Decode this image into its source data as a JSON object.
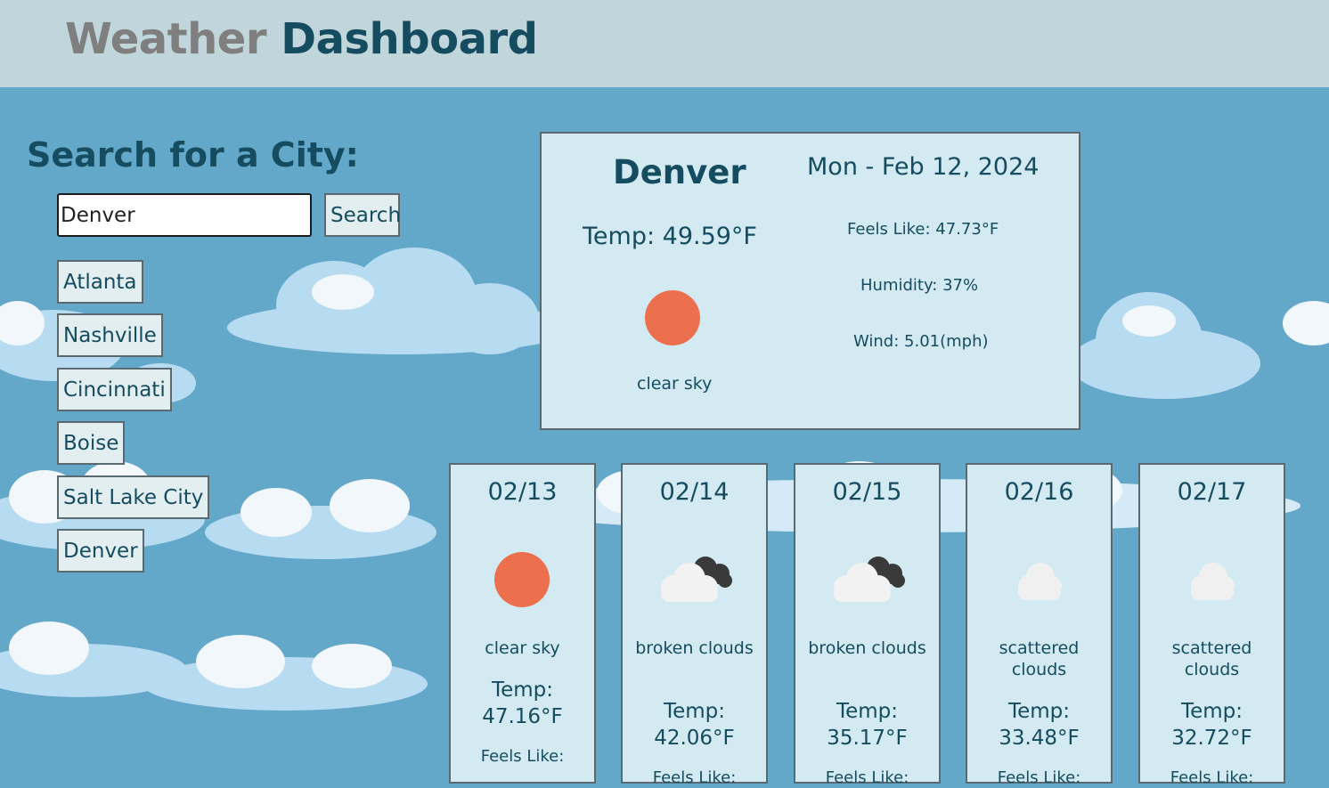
{
  "header": {
    "title_part1": "Weather",
    "title_part2": "Dashboard"
  },
  "search": {
    "title": "Search for a City:",
    "input_value": "Denver",
    "button_label": "Search",
    "history": [
      "Atlanta",
      "Nashville",
      "Cincinnati",
      "Boise",
      "Salt Lake City",
      "Denver"
    ]
  },
  "current": {
    "city": "Denver",
    "date": "Mon - Feb 12, 2024",
    "temp": "Temp:  49.59°F",
    "feels_like": "Feels Like:  47.73°F",
    "humidity": "Humidity:  37%",
    "wind": "Wind:  5.01(mph)",
    "description": "clear sky",
    "icon": "sun-icon"
  },
  "forecast": [
    {
      "date": "02/13",
      "icon": "sun-icon",
      "desc": "clear sky",
      "temp_label": "Temp:",
      "temp": "47.16°F",
      "feels_label": "Feels Like:"
    },
    {
      "date": "02/14",
      "icon": "broken-clouds-icon",
      "desc": "broken clouds",
      "temp_label": "Temp:",
      "temp": "42.06°F",
      "feels_label": "Feels Like:"
    },
    {
      "date": "02/15",
      "icon": "broken-clouds-icon",
      "desc": "broken clouds",
      "temp_label": "Temp:",
      "temp": "35.17°F",
      "feels_label": "Feels Like:"
    },
    {
      "date": "02/16",
      "icon": "scattered-clouds-icon",
      "desc": "scattered clouds",
      "temp_label": "Temp:",
      "temp": "33.48°F",
      "feels_label": "Feels Like:"
    },
    {
      "date": "02/17",
      "icon": "scattered-clouds-icon",
      "desc": "scattered clouds",
      "temp_label": "Temp:",
      "temp": "32.72°F",
      "feels_label": "Feels Like:"
    }
  ],
  "colors": {
    "header_bg": "#c1d6db",
    "accent": "#154c5f",
    "card_bg": "#d3eaf2",
    "sun": "#ec6f4e",
    "sky": "#63a8c9"
  }
}
